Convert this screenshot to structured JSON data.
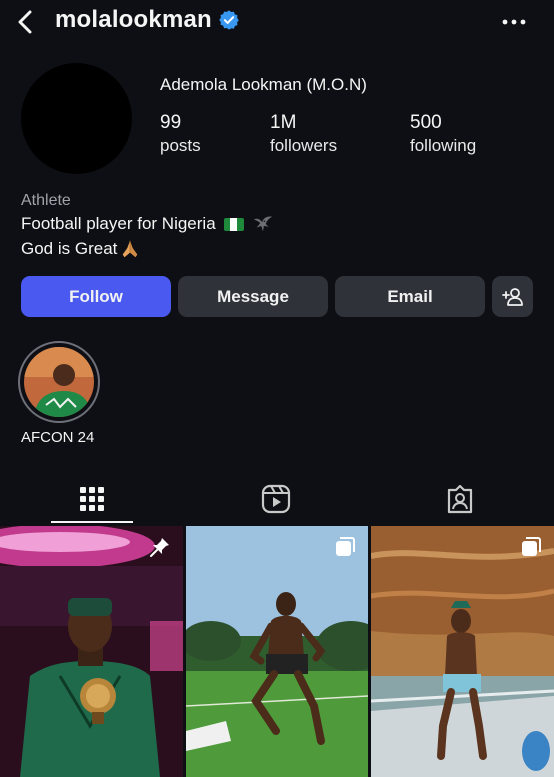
{
  "header": {
    "username": "molalookman",
    "back_icon": "chevron-left-icon",
    "verified_icon": "verified-badge-icon",
    "more_icon": "more-horizontal-icon"
  },
  "profile": {
    "display_name": "Ademola Lookman (M.O.N)",
    "stats": [
      {
        "value": "99",
        "label": "posts"
      },
      {
        "value": "1M",
        "label": "followers"
      },
      {
        "value": "500",
        "label": "following"
      }
    ],
    "category": "Athlete",
    "bio_line1": "Football player for Nigeria",
    "bio_line2": "God is Great"
  },
  "actions": {
    "follow": "Follow",
    "message": "Message",
    "email": "Email",
    "add_user_icon": "add-user-icon"
  },
  "highlights": [
    {
      "label": "AFCON 24"
    }
  ],
  "tabs": [
    "grid-icon",
    "reels-icon",
    "tagged-icon"
  ],
  "posts": [
    {
      "badge": "pin-icon",
      "description": "award"
    },
    {
      "badge": "carousel-icon",
      "description": "training"
    },
    {
      "badge": "carousel-icon",
      "description": "boat"
    }
  ],
  "colors": {
    "background": "#0e0f14",
    "accent": "#4a5af0",
    "button": "#2f3238",
    "verified": "#3897f0"
  }
}
